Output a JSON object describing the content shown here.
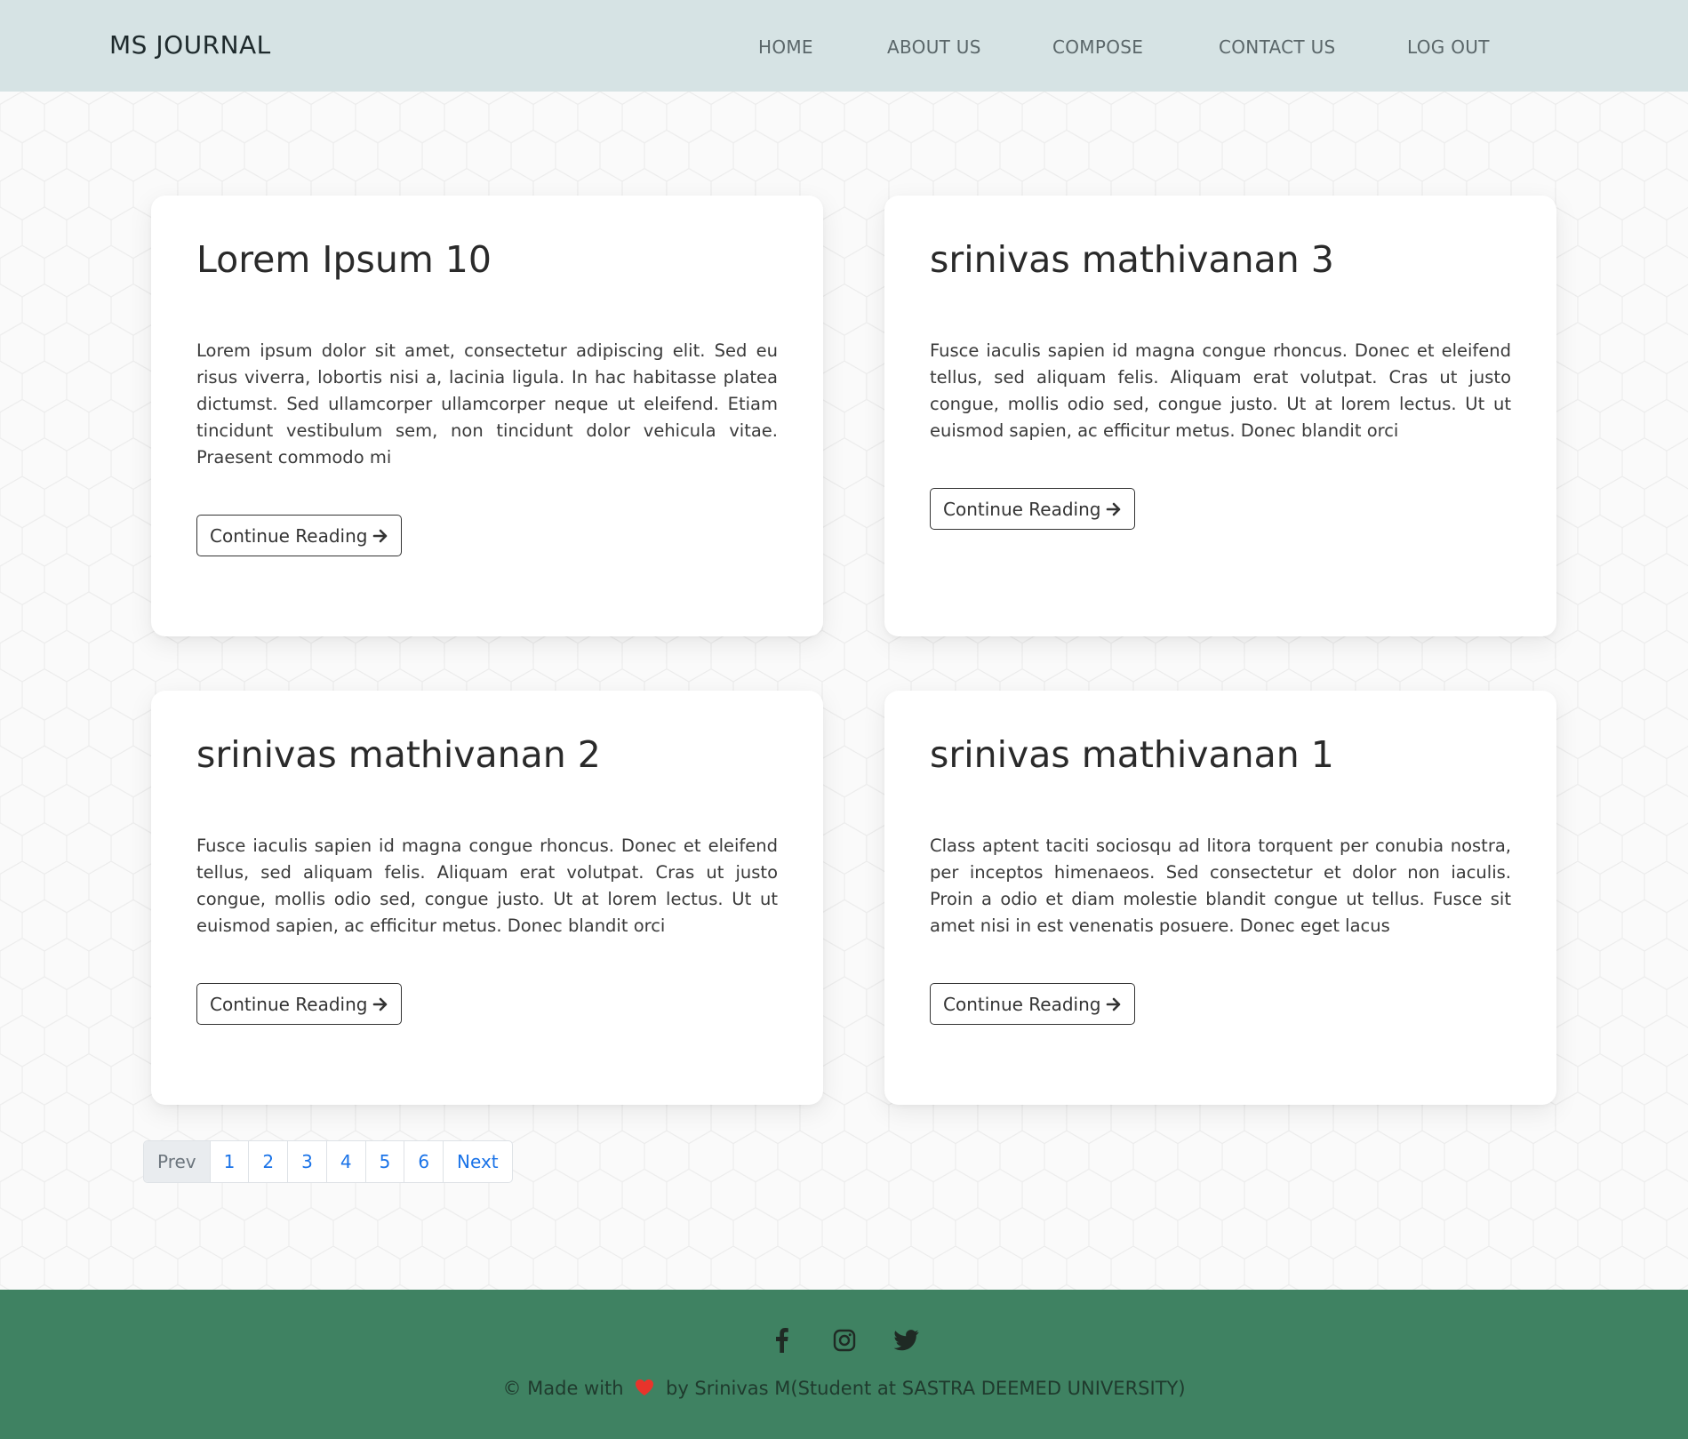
{
  "navbar": {
    "brand": "MS JOURNAL",
    "links": [
      "HOME",
      "ABOUT US",
      "COMPOSE",
      "CONTACT US",
      "LOG OUT"
    ]
  },
  "posts": [
    {
      "title": "Lorem Ipsum 10",
      "excerpt": "Lorem ipsum dolor sit amet, consectetur adipiscing elit. Sed eu risus viverra, lobortis nisi a, lacinia ligula. In hac habitasse platea dictumst. Sed ullamcorper ullamcorper neque ut eleifend. Etiam tincidunt vestibulum sem, non tincidunt dolor vehicula vitae. Praesent commodo mi",
      "button": "Continue Reading"
    },
    {
      "title": "srinivas mathivanan 3",
      "excerpt": "Fusce iaculis sapien id magna congue rhoncus. Donec et eleifend tellus, sed aliquam felis. Aliquam erat volutpat. Cras ut justo congue, mollis odio sed, congue justo. Ut at lorem lectus. Ut ut euismod sapien, ac efficitur metus. Donec blandit orci",
      "button": "Continue Reading"
    },
    {
      "title": "srinivas mathivanan 2",
      "excerpt": "Fusce iaculis sapien id magna congue rhoncus. Donec et eleifend tellus, sed aliquam felis. Aliquam erat volutpat. Cras ut justo congue, mollis odio sed, congue justo. Ut at lorem lectus. Ut ut euismod sapien, ac efficitur metus. Donec blandit orci",
      "button": "Continue Reading"
    },
    {
      "title": "srinivas mathivanan 1",
      "excerpt": "Class aptent taciti sociosqu ad litora torquent per conubia nostra, per inceptos himenaeos. Sed consectetur et dolor non iaculis. Proin a odio et diam molestie blandit congue ut tellus. Fusce sit amet nisi in est venenatis posuere. Donec eget lacus",
      "button": "Continue Reading"
    }
  ],
  "pagination": {
    "prev": "Prev",
    "pages": [
      "1",
      "2",
      "3",
      "4",
      "5",
      "6"
    ],
    "next": "Next"
  },
  "footer": {
    "social_icons": [
      "facebook-icon",
      "instagram-icon",
      "twitter-icon"
    ],
    "credit_before": "© Made with",
    "credit_after": "by Srinivas M(Student at SASTRA DEEMED UNIVERSITY)",
    "heart_color": "#e8342b"
  },
  "colors": {
    "navbar_bg": "#d6e3e4",
    "footer_bg": "#3f8262",
    "link_blue": "#1a73e8"
  }
}
